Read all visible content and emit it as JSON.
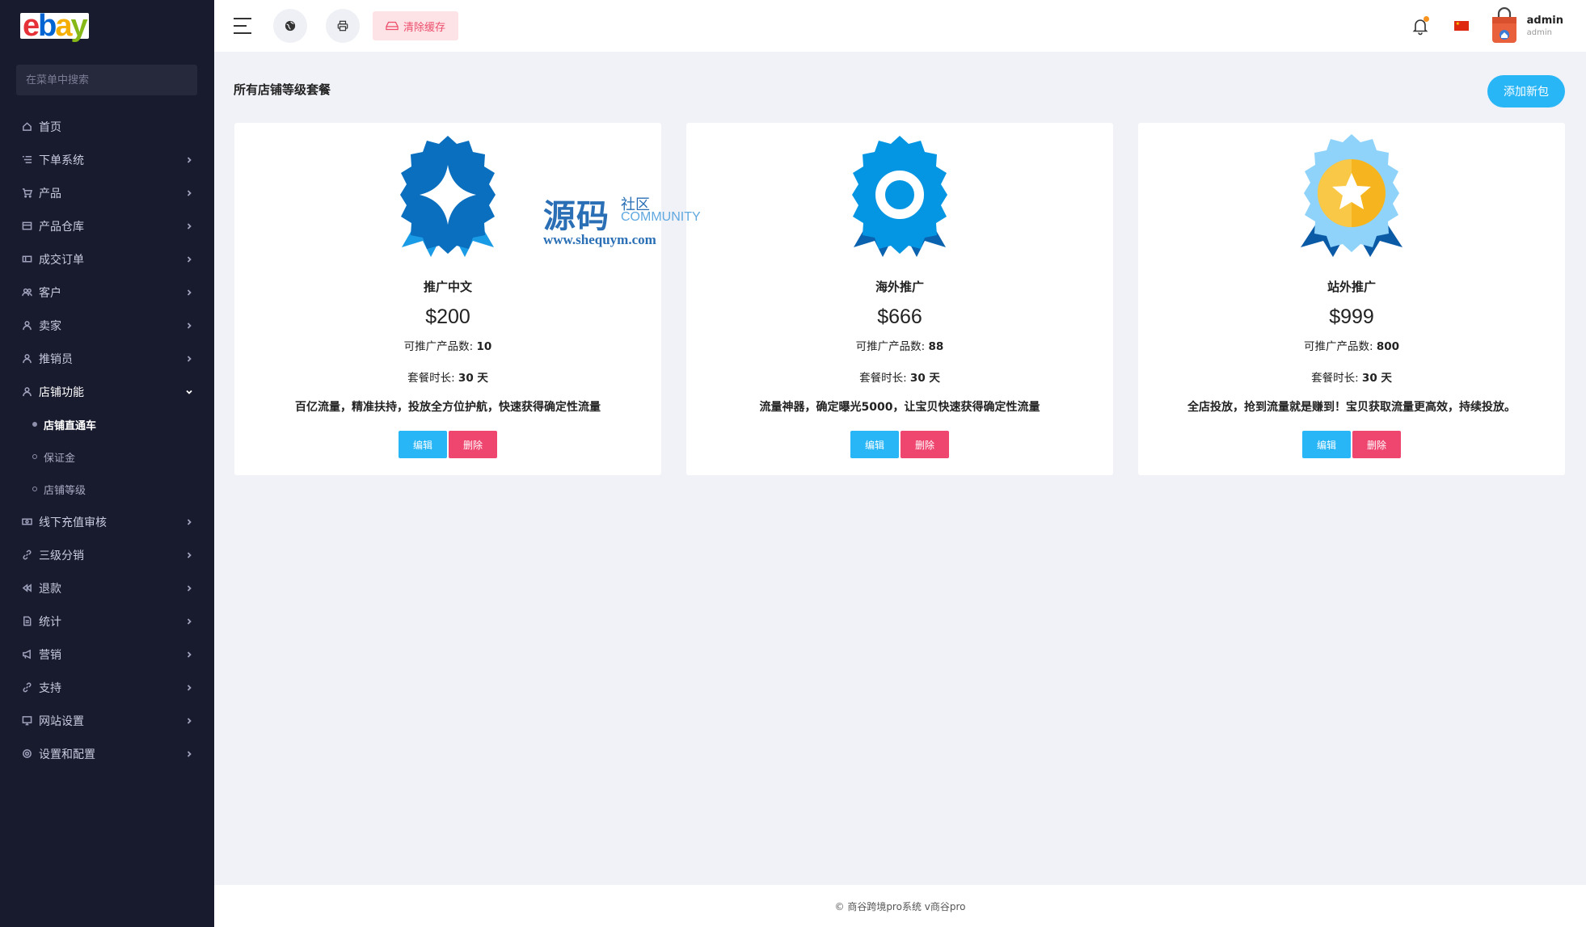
{
  "brand": {
    "logo_letters": [
      "e",
      "b",
      "a",
      "y"
    ],
    "logo_colors": [
      "#e53238",
      "#0064d2",
      "#f5af02",
      "#86b817"
    ]
  },
  "sidebar": {
    "search_placeholder": "在菜单中搜索",
    "items": [
      {
        "label": "首页",
        "icon": "home-icon",
        "has_children": false
      },
      {
        "label": "下单系统",
        "icon": "list-icon",
        "has_children": true
      },
      {
        "label": "产品",
        "icon": "cart-icon",
        "has_children": true
      },
      {
        "label": "产品仓库",
        "icon": "warehouse-icon",
        "has_children": true
      },
      {
        "label": "成交订单",
        "icon": "ticket-icon",
        "has_children": true
      },
      {
        "label": "客户",
        "icon": "users-icon",
        "has_children": true
      },
      {
        "label": "卖家",
        "icon": "user-icon",
        "has_children": true
      },
      {
        "label": "推销员",
        "icon": "user-icon",
        "has_children": true
      },
      {
        "label": "店铺功能",
        "icon": "user-icon",
        "has_children": true,
        "open": true,
        "children": [
          {
            "label": "店铺直通车",
            "active": true
          },
          {
            "label": "保证金",
            "active": false
          },
          {
            "label": "店铺等级",
            "active": false
          }
        ]
      },
      {
        "label": "线下充值审核",
        "icon": "cash-icon",
        "has_children": true
      },
      {
        "label": "三级分销",
        "icon": "link-icon",
        "has_children": true
      },
      {
        "label": "退款",
        "icon": "rewind-icon",
        "has_children": true
      },
      {
        "label": "统计",
        "icon": "file-icon",
        "has_children": true
      },
      {
        "label": "营销",
        "icon": "megaphone-icon",
        "has_children": true
      },
      {
        "label": "支持",
        "icon": "link-icon",
        "has_children": true
      },
      {
        "label": "网站设置",
        "icon": "monitor-icon",
        "has_children": true
      },
      {
        "label": "设置和配置",
        "icon": "gear-icon",
        "has_children": true
      }
    ]
  },
  "header": {
    "clear_cache_label": "清除缓存",
    "user": {
      "name": "admin",
      "role": "admin"
    },
    "language_flag": "cn-flag"
  },
  "page": {
    "title": "所有店铺等级套餐",
    "add_button": "添加新包"
  },
  "packages": [
    {
      "name": "推广中文",
      "price": "$200",
      "products_label": "可推广产品数: ",
      "products": "10",
      "duration_label": "套餐时长: ",
      "duration": "30 天",
      "description": "百亿流量，精准扶持，投放全方位护航，快速获得确定性流量",
      "edit": "编辑",
      "delete": "删除",
      "medal": "diamond-medal-icon",
      "medal_color": "#0a74c9"
    },
    {
      "name": "海外推广",
      "price": "$666",
      "products_label": "可推广产品数: ",
      "products": "88",
      "duration_label": "套餐时长: ",
      "duration": "30 天",
      "description": "流量神器，确定曝光5000，让宝贝快速获得确定性流量",
      "edit": "编辑",
      "delete": "删除",
      "medal": "ring-medal-icon",
      "medal_color": "#0596e3"
    },
    {
      "name": "站外推广",
      "price": "$999",
      "products_label": "可推广产品数: ",
      "products": "800",
      "duration_label": "套餐时长: ",
      "duration": "30 天",
      "description": "全店投放，抢到流量就是赚到！宝贝获取流量更高效，持续投放。",
      "edit": "编辑",
      "delete": "删除",
      "medal": "star-medal-icon",
      "medal_color": "#f6b51e"
    }
  ],
  "watermark": {
    "big": "源码",
    "small": "社区",
    "community": "COMMUNITY",
    "url": "www.shequym.com"
  },
  "footer": {
    "text": "© 商谷跨境pro系统 v商谷pro"
  },
  "colors": {
    "accent": "#29b6f6",
    "danger": "#ef4670",
    "sidebar_bg": "#181a2d"
  }
}
